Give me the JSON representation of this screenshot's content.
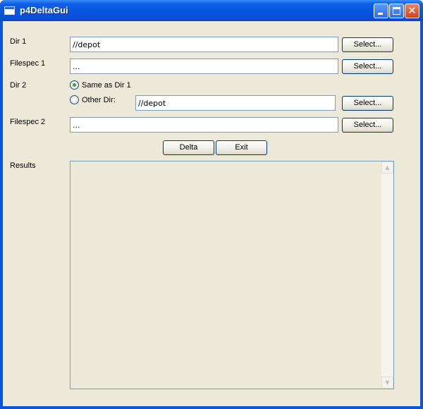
{
  "window": {
    "title": "p4DeltaGui"
  },
  "labels": {
    "dir1": "Dir 1",
    "filespec1": "Filespec 1",
    "dir2": "Dir 2",
    "filespec2": "Filespec 2",
    "results": "Results"
  },
  "fields": {
    "dir1": "//depot",
    "filespec1": "...",
    "other_dir": "//depot",
    "filespec2": "..."
  },
  "radios": {
    "same_as_dir1": {
      "label": "Same as Dir 1",
      "checked": true
    },
    "other_dir": {
      "label": "Other Dir:",
      "checked": false
    }
  },
  "buttons": {
    "select": "Select...",
    "delta": "Delta",
    "exit": "Exit"
  },
  "icons": {
    "app": "window-icon",
    "minimize": "minimize-icon",
    "maximize": "maximize-icon",
    "close": "close-icon",
    "scroll_up": "chevron-up-icon",
    "scroll_down": "chevron-down-icon"
  },
  "colors": {
    "title_bar": "#0a55e0",
    "client_bg": "#ece9d8",
    "close_button": "#d4421c",
    "radio_dot": "#2fa43a"
  }
}
